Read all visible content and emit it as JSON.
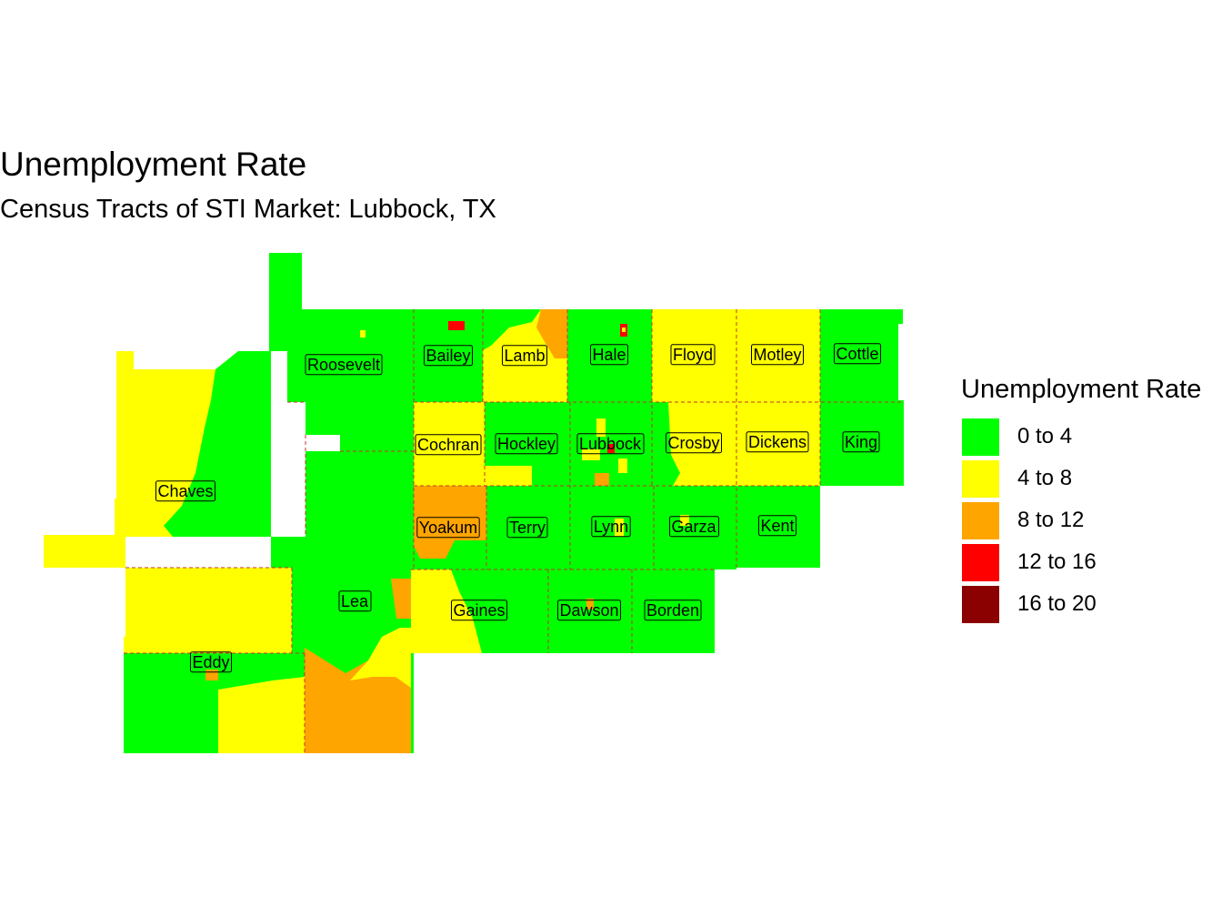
{
  "title": "Unemployment Rate",
  "subtitle": "Census Tracts of STI Market: Lubbock, TX",
  "legend": {
    "title": "Unemployment Rate",
    "items": [
      {
        "label": "0 to 4",
        "color": "#00ff00"
      },
      {
        "label": "4 to 8",
        "color": "#ffff00"
      },
      {
        "label": "8 to 12",
        "color": "#ffa500"
      },
      {
        "label": "12 to 16",
        "color": "#ff0000"
      },
      {
        "label": "16 to 20",
        "color": "#8b0000"
      }
    ]
  },
  "counties": [
    {
      "name": "Roosevelt",
      "rate_class": "0 to 4"
    },
    {
      "name": "Bailey",
      "rate_class": "0 to 4"
    },
    {
      "name": "Lamb",
      "rate_class": "4 to 8"
    },
    {
      "name": "Hale",
      "rate_class": "0 to 4"
    },
    {
      "name": "Floyd",
      "rate_class": "4 to 8"
    },
    {
      "name": "Motley",
      "rate_class": "4 to 8"
    },
    {
      "name": "Cottle",
      "rate_class": "0 to 4"
    },
    {
      "name": "Chaves",
      "rate_class": "4 to 8"
    },
    {
      "name": "Cochran",
      "rate_class": "4 to 8"
    },
    {
      "name": "Hockley",
      "rate_class": "0 to 4"
    },
    {
      "name": "Lubbock",
      "rate_class": "0 to 4"
    },
    {
      "name": "Crosby",
      "rate_class": "4 to 8"
    },
    {
      "name": "Dickens",
      "rate_class": "4 to 8"
    },
    {
      "name": "King",
      "rate_class": "0 to 4"
    },
    {
      "name": "Yoakum",
      "rate_class": "8 to 12"
    },
    {
      "name": "Terry",
      "rate_class": "0 to 4"
    },
    {
      "name": "Lynn",
      "rate_class": "0 to 4"
    },
    {
      "name": "Garza",
      "rate_class": "0 to 4"
    },
    {
      "name": "Kent",
      "rate_class": "0 to 4"
    },
    {
      "name": "Lea",
      "rate_class": "0 to 4"
    },
    {
      "name": "Gaines",
      "rate_class": "0 to 4"
    },
    {
      "name": "Dawson",
      "rate_class": "0 to 4"
    },
    {
      "name": "Borden",
      "rate_class": "0 to 4"
    },
    {
      "name": "Eddy",
      "rate_class": "0 to 4"
    }
  ]
}
